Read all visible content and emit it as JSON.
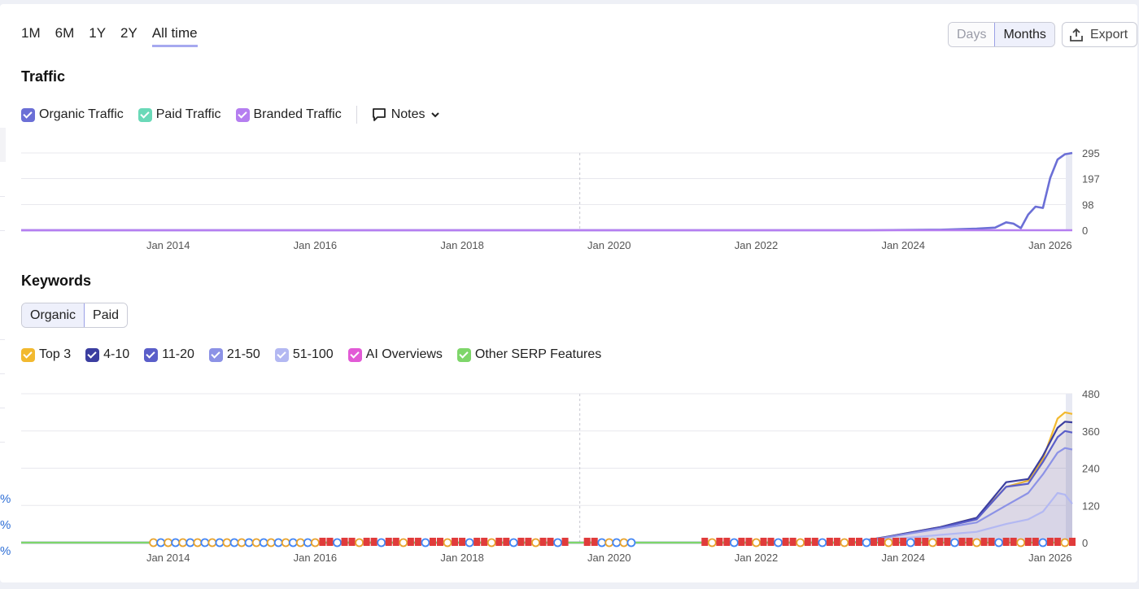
{
  "range_tabs": [
    "1M",
    "6M",
    "1Y",
    "2Y",
    "All time"
  ],
  "active_range": "All time",
  "granularity": {
    "days": "Days",
    "months": "Months",
    "active": "Months"
  },
  "export_label": "Export",
  "side_percent_marks": [
    "%",
    "%",
    "%"
  ],
  "traffic": {
    "title": "Traffic",
    "legend": [
      {
        "label": "Organic Traffic",
        "color": "#6b6fd6"
      },
      {
        "label": "Paid Traffic",
        "color": "#6ad9b8"
      },
      {
        "label": "Branded Traffic",
        "color": "#b57ef0"
      }
    ],
    "notes_label": "Notes"
  },
  "keywords": {
    "title": "Keywords",
    "tabs": [
      "Organic",
      "Paid"
    ],
    "active_tab": "Organic",
    "legend": [
      {
        "label": "Top 3",
        "color": "#f2b92f"
      },
      {
        "label": "4-10",
        "color": "#3b3ea0"
      },
      {
        "label": "11-20",
        "color": "#5a5ec9"
      },
      {
        "label": "21-50",
        "color": "#8c92e6"
      },
      {
        "label": "51-100",
        "color": "#b3b8f2"
      },
      {
        "label": "AI Overviews",
        "color": "#e25ad6"
      },
      {
        "label": "Other SERP Features",
        "color": "#7ed66a"
      }
    ]
  },
  "chart_data": [
    {
      "type": "line",
      "name": "traffic",
      "x_ticks": [
        "Jan 2014",
        "Jan 2016",
        "Jan 2018",
        "Jan 2020",
        "Jan 2022",
        "Jan 2024",
        "Jan 2026"
      ],
      "x_range": [
        2012.0,
        2026.3
      ],
      "y_ticks": [
        0,
        98,
        197,
        295
      ],
      "ylim": [
        0,
        295
      ],
      "grid": true,
      "marker_line_x": 2019.6,
      "series": [
        {
          "name": "Organic Traffic",
          "color": "#6b6fd6",
          "points": [
            [
              2012.0,
              0
            ],
            [
              2023.5,
              0
            ],
            [
              2024.5,
              2
            ],
            [
              2025.0,
              6
            ],
            [
              2025.25,
              10
            ],
            [
              2025.4,
              30
            ],
            [
              2025.5,
              25
            ],
            [
              2025.6,
              8
            ],
            [
              2025.7,
              60
            ],
            [
              2025.8,
              90
            ],
            [
              2025.9,
              85
            ],
            [
              2026.0,
              200
            ],
            [
              2026.1,
              270
            ],
            [
              2026.2,
              290
            ],
            [
              2026.3,
              295
            ]
          ]
        },
        {
          "name": "Branded Traffic",
          "color": "#b57ef0",
          "points": [
            [
              2012.0,
              0
            ],
            [
              2026.3,
              0
            ]
          ]
        }
      ]
    },
    {
      "type": "area",
      "name": "keywords",
      "x_ticks": [
        "Jan 2014",
        "Jan 2016",
        "Jan 2018",
        "Jan 2020",
        "Jan 2022",
        "Jan 2024",
        "Jan 2026"
      ],
      "x_range": [
        2012.0,
        2026.3
      ],
      "y_ticks": [
        0,
        120,
        240,
        360,
        480
      ],
      "ylim": [
        0,
        480
      ],
      "grid": true,
      "marker_line_x": 2019.6,
      "series": [
        {
          "name": "Top 3",
          "color": "#f2b92f",
          "points": [
            [
              2012,
              0
            ],
            [
              2023.3,
              0
            ],
            [
              2023.8,
              20
            ],
            [
              2024.5,
              50
            ],
            [
              2025.0,
              80
            ],
            [
              2025.4,
              180
            ],
            [
              2025.7,
              200
            ],
            [
              2025.9,
              270
            ],
            [
              2026.1,
              400
            ],
            [
              2026.2,
              420
            ],
            [
              2026.3,
              415
            ]
          ]
        },
        {
          "name": "4-10",
          "color": "#3b3ea0",
          "points": [
            [
              2012,
              0
            ],
            [
              2023.3,
              0
            ],
            [
              2023.8,
              20
            ],
            [
              2024.5,
              50
            ],
            [
              2025.0,
              80
            ],
            [
              2025.4,
              195
            ],
            [
              2025.7,
              205
            ],
            [
              2025.9,
              280
            ],
            [
              2026.1,
              370
            ],
            [
              2026.2,
              390
            ],
            [
              2026.3,
              388
            ]
          ]
        },
        {
          "name": "11-20",
          "color": "#5a5ec9",
          "points": [
            [
              2012,
              0
            ],
            [
              2023.3,
              0
            ],
            [
              2023.8,
              18
            ],
            [
              2024.5,
              48
            ],
            [
              2025.0,
              75
            ],
            [
              2025.4,
              180
            ],
            [
              2025.7,
              190
            ],
            [
              2025.9,
              260
            ],
            [
              2026.1,
              340
            ],
            [
              2026.2,
              360
            ],
            [
              2026.3,
              355
            ]
          ]
        },
        {
          "name": "21-50",
          "color": "#8c92e6",
          "points": [
            [
              2012,
              0
            ],
            [
              2023.3,
              0
            ],
            [
              2023.8,
              18
            ],
            [
              2024.5,
              45
            ],
            [
              2025.0,
              65
            ],
            [
              2025.4,
              120
            ],
            [
              2025.7,
              160
            ],
            [
              2025.9,
              220
            ],
            [
              2026.1,
              290
            ],
            [
              2026.2,
              305
            ],
            [
              2026.3,
              300
            ]
          ]
        },
        {
          "name": "51-100",
          "color": "#b3b8f2",
          "points": [
            [
              2012,
              0
            ],
            [
              2023.3,
              0
            ],
            [
              2023.8,
              10
            ],
            [
              2024.5,
              25
            ],
            [
              2025.0,
              35
            ],
            [
              2025.4,
              60
            ],
            [
              2025.7,
              75
            ],
            [
              2025.9,
              100
            ],
            [
              2026.1,
              160
            ],
            [
              2026.2,
              155
            ],
            [
              2026.3,
              125
            ]
          ]
        },
        {
          "name": "Other SERP Features",
          "color": "#7ed66a",
          "points": [
            [
              2012,
              0
            ],
            [
              2026.3,
              0
            ]
          ]
        }
      ],
      "serp_marker_range": [
        2013.8,
        2026.3
      ]
    }
  ]
}
